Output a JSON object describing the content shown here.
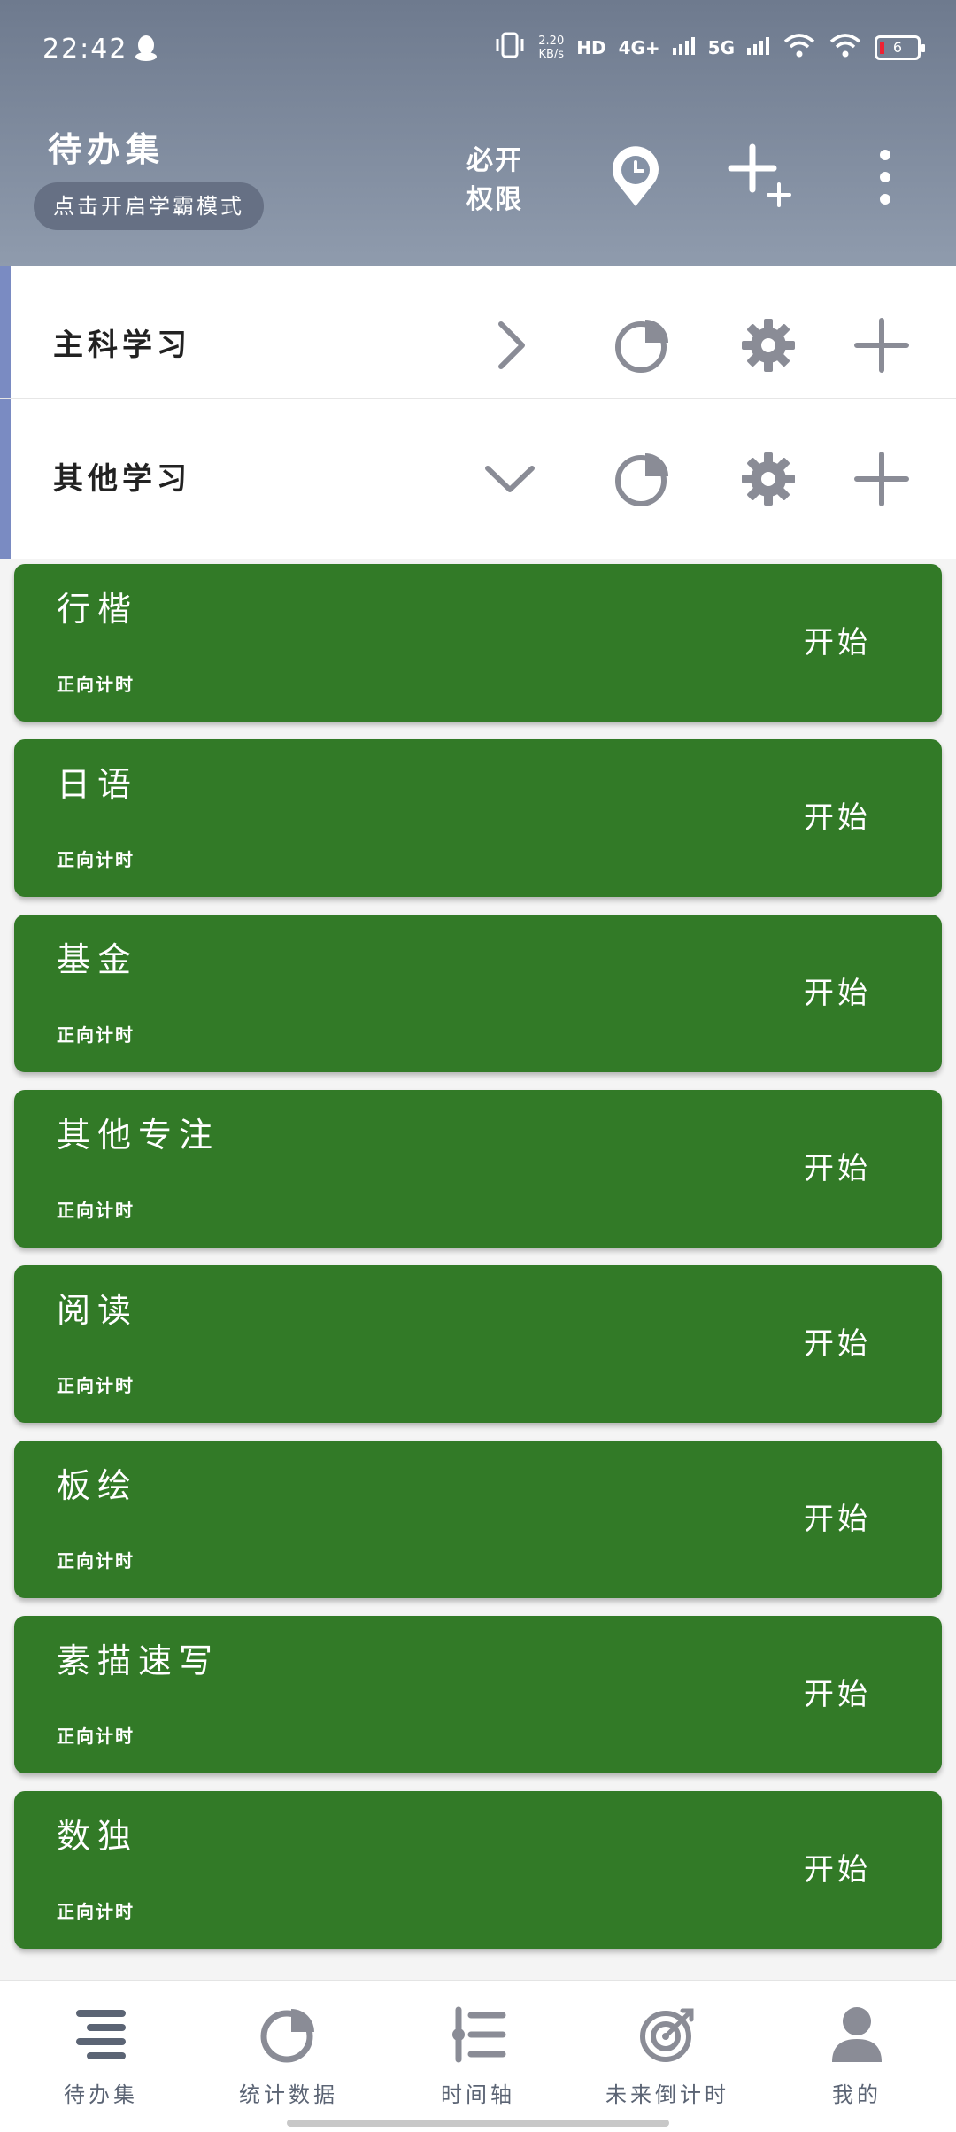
{
  "status_bar": {
    "time": "22:42",
    "net_speed_value": "2.20",
    "net_speed_unit": "KB/s",
    "hd": "HD",
    "sim_4g": "4G+",
    "sim_5g": "5G",
    "battery": "6"
  },
  "header": {
    "title": "待办集",
    "xueba_mode_label": "点击开启学霸模式",
    "permission_line1": "必开",
    "permission_line2": "权限"
  },
  "categories": [
    {
      "name": "主科学习",
      "state": "collapsed"
    },
    {
      "name": "其他学习",
      "state": "expanded"
    }
  ],
  "tasks": [
    {
      "name": "行楷",
      "mode": "正向计时",
      "action": "开始"
    },
    {
      "name": "日语",
      "mode": "正向计时",
      "action": "开始"
    },
    {
      "name": "基金",
      "mode": "正向计时",
      "action": "开始"
    },
    {
      "name": "其他专注",
      "mode": "正向计时",
      "action": "开始"
    },
    {
      "name": "阅读",
      "mode": "正向计时",
      "action": "开始"
    },
    {
      "name": "板绘",
      "mode": "正向计时",
      "action": "开始"
    },
    {
      "name": "素描速写",
      "mode": "正向计时",
      "action": "开始"
    },
    {
      "name": "数独",
      "mode": "正向计时",
      "action": "开始"
    }
  ],
  "bottom_nav": [
    {
      "label": "待办集",
      "icon": "list-icon"
    },
    {
      "label": "统计数据",
      "icon": "pie-chart-icon"
    },
    {
      "label": "时间轴",
      "icon": "timeline-icon"
    },
    {
      "label": "未来倒计时",
      "icon": "target-icon"
    },
    {
      "label": "我的",
      "icon": "user-icon"
    }
  ],
  "colors": {
    "header": "#7d889b",
    "task_green": "#327a27",
    "category_accent": "#7a8bc2",
    "icon_gray": "#8a8c96"
  }
}
